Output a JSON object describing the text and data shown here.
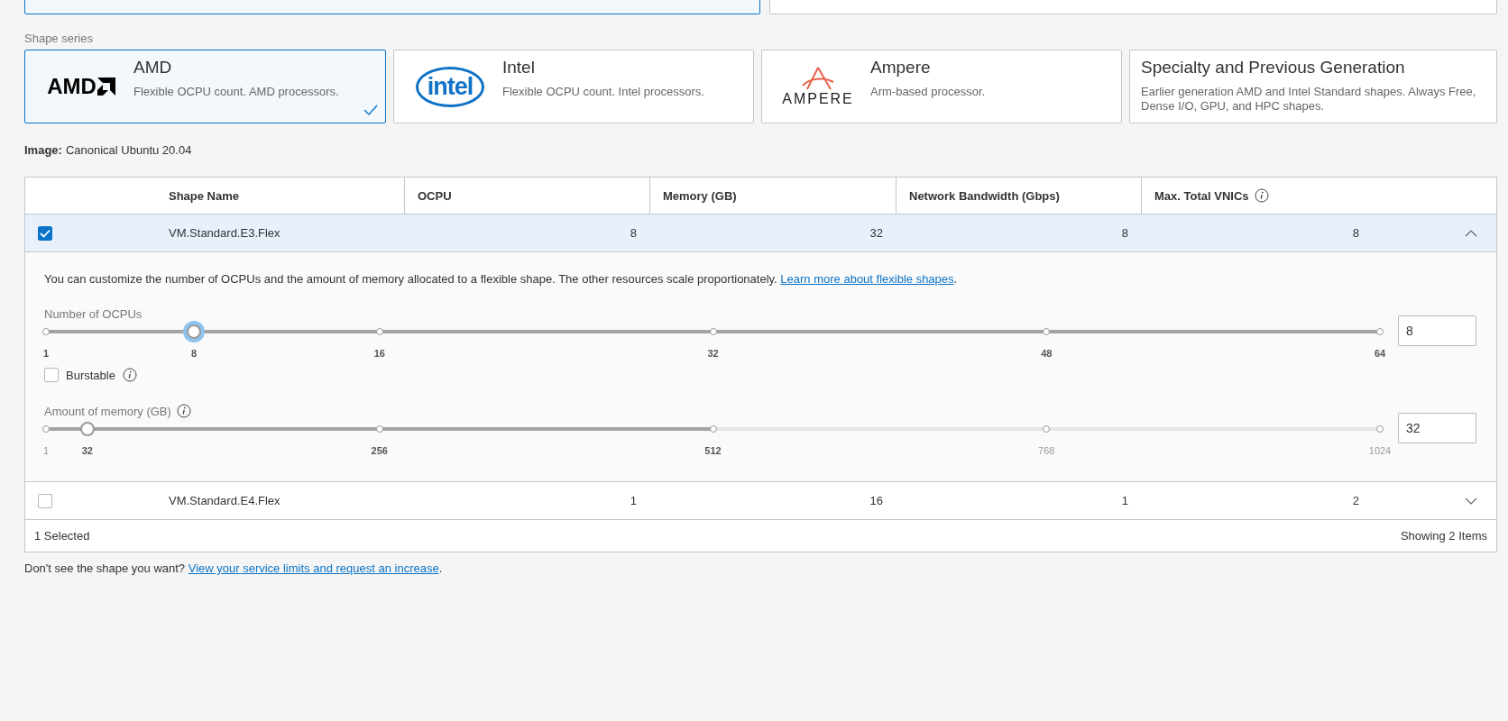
{
  "top_options": [
    {
      "selected": true
    },
    {
      "selected": false
    }
  ],
  "shape_series": {
    "label": "Shape series",
    "cards": [
      {
        "title": "AMD",
        "description": "Flexible OCPU count. AMD processors.",
        "selected": true,
        "logo": {
          "kind": "amd",
          "text": "AMD"
        }
      },
      {
        "title": "Intel",
        "description": "Flexible OCPU count. Intel processors.",
        "selected": false,
        "logo": {
          "kind": "intel",
          "text": "intel"
        }
      },
      {
        "title": "Ampere",
        "description": "Arm-based processor.",
        "selected": false,
        "logo": {
          "kind": "ampere",
          "text": "AMPERE"
        }
      },
      {
        "title": "Specialty and Previous Generation",
        "description": "Earlier generation AMD and Intel Standard shapes. Always Free, Dense I/O, GPU, and HPC shapes.",
        "selected": false
      }
    ]
  },
  "image": {
    "label": "Image:",
    "value": "Canonical Ubuntu 20.04"
  },
  "table": {
    "columns": [
      {
        "label": "Shape Name"
      },
      {
        "label": "OCPU"
      },
      {
        "label": "Memory (GB)"
      },
      {
        "label": "Network Bandwidth (Gbps)"
      },
      {
        "label": "Max. Total VNICs",
        "info": true
      }
    ],
    "rows": [
      {
        "checked": true,
        "expanded": true,
        "cells": [
          "VM.Standard.E3.Flex",
          "8",
          "32",
          "8",
          "8"
        ]
      },
      {
        "checked": false,
        "expanded": false,
        "cells": [
          "VM.Standard.E4.Flex",
          "1",
          "16",
          "1",
          "2"
        ]
      }
    ],
    "details": {
      "description": "You can customize the number of OCPUs and the amount of memory allocated to a flexible shape. The other resources scale proportionately. ",
      "link": "Learn more about flexible shapes",
      "after": ".",
      "ocpu_slider": {
        "label": "Number of OCPUs",
        "info": false,
        "level": 0.111,
        "focused": true,
        "value_label": "8",
        "input_value": "8",
        "ticks": [
          {
            "text": "1",
            "enabled": true
          },
          {
            "text": "16",
            "enabled": true
          },
          {
            "text": "32",
            "enabled": true
          },
          {
            "text": "48",
            "enabled": true
          },
          {
            "text": "64",
            "enabled": true
          }
        ]
      },
      "burstable": {
        "label": "Burstable",
        "checked": false,
        "info": true
      },
      "memory_slider": {
        "label": "Amount of memory (GB)",
        "info": true,
        "level": 0.031,
        "focused": false,
        "value_label": "32",
        "input_value": "32",
        "ticks": [
          {
            "text": "1",
            "enabled": false
          },
          {
            "text": "256",
            "enabled": true
          },
          {
            "text": "512",
            "enabled": true
          },
          {
            "text": "768",
            "enabled": false
          },
          {
            "text": "1024",
            "enabled": false
          }
        ]
      }
    },
    "footer": {
      "selected": "1 Selected",
      "showing": "Showing 2 Items"
    }
  },
  "note": {
    "text": "Don't see the shape you want? ",
    "link": "View your service limits and request an increase",
    "after": "."
  }
}
